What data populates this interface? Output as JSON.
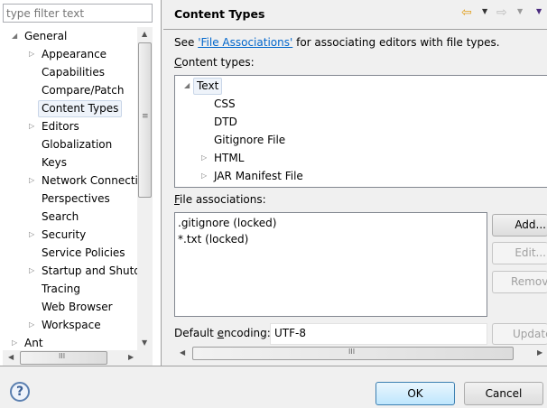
{
  "filter": {
    "placeholder": "type filter text"
  },
  "nav_tree": [
    {
      "label": "General",
      "level": 0,
      "expanded": true
    },
    {
      "label": "Appearance",
      "level": 1,
      "expandable": true
    },
    {
      "label": "Capabilities",
      "level": 1
    },
    {
      "label": "Compare/Patch",
      "level": 1
    },
    {
      "label": "Content Types",
      "level": 1,
      "selected": true
    },
    {
      "label": "Editors",
      "level": 1,
      "expandable": true
    },
    {
      "label": "Globalization",
      "level": 1
    },
    {
      "label": "Keys",
      "level": 1
    },
    {
      "label": "Network Connections",
      "level": 1,
      "expandable": true
    },
    {
      "label": "Perspectives",
      "level": 1
    },
    {
      "label": "Search",
      "level": 1
    },
    {
      "label": "Security",
      "level": 1,
      "expandable": true
    },
    {
      "label": "Service Policies",
      "level": 1
    },
    {
      "label": "Startup and Shutdown",
      "level": 1,
      "expandable": true
    },
    {
      "label": "Tracing",
      "level": 1
    },
    {
      "label": "Web Browser",
      "level": 1
    },
    {
      "label": "Workspace",
      "level": 1,
      "expandable": true
    },
    {
      "label": "Ant",
      "level": 0,
      "expandable": true
    }
  ],
  "page": {
    "title": "Content Types",
    "desc_prefix": "See ",
    "desc_link": "'File Associations'",
    "desc_suffix": " for associating editors with file types.",
    "content_types_label": "ontent types:",
    "content_types_mnemonic": "C",
    "content_tree": [
      {
        "label": "Text",
        "level": 0,
        "expanded": true,
        "selected": true
      },
      {
        "label": "CSS",
        "level": 1
      },
      {
        "label": "DTD",
        "level": 1
      },
      {
        "label": "Gitignore File",
        "level": 1
      },
      {
        "label": "HTML",
        "level": 1,
        "expandable": true
      },
      {
        "label": "JAR Manifest File",
        "level": 1,
        "expandable": true
      }
    ],
    "file_assoc_mnemonic": "F",
    "file_assoc_label": "ile associations:",
    "file_associations": [
      ".gitignore (locked)",
      "*.txt (locked)"
    ],
    "buttons": {
      "add": "Add...",
      "edit": "Edit...",
      "remove": "Remove",
      "update": "Update"
    },
    "encoding_label_a": "Default ",
    "encoding_mnemonic": "e",
    "encoding_label_b": "ncoding:",
    "encoding_value": "UTF-8"
  },
  "footer": {
    "ok": "OK",
    "cancel": "Cancel"
  },
  "icons": {
    "back": "arrow-left-icon",
    "forward": "arrow-right-icon",
    "menu": "view-menu-icon",
    "help": "help-icon"
  },
  "colors": {
    "link": "#0066cc",
    "selection": "#eef3fa",
    "ok_border": "#3c7fb1"
  }
}
